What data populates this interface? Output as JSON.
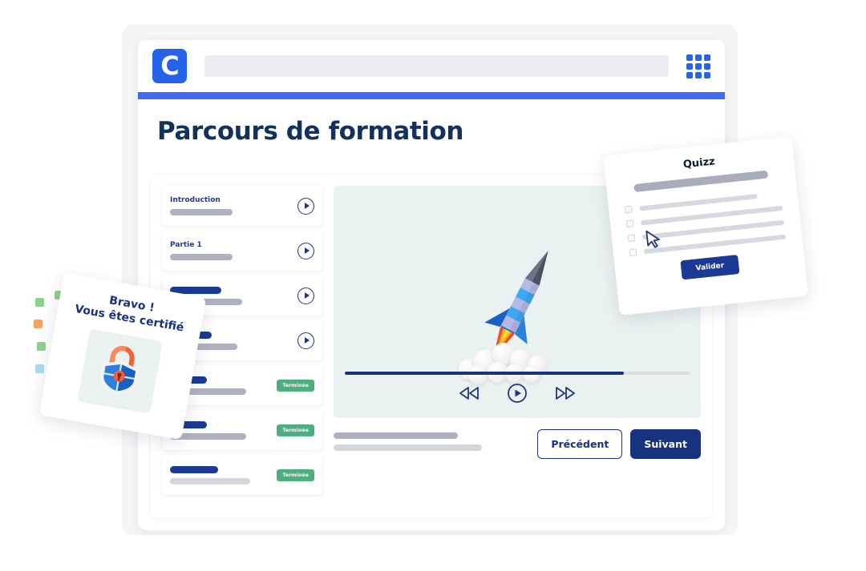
{
  "header": {
    "logo_letter": "C",
    "logo_name": "coorpacademy-logo",
    "search_value": "",
    "search_placeholder": "",
    "apps_icon": "apps-grid-icon",
    "accent_bar_color": "#4169f0",
    "logo_bg_color": "#2563eb"
  },
  "page": {
    "title": "Parcours de formation",
    "title_color": "#12315c",
    "background_color": "#f4f5f7"
  },
  "lessons": [
    {
      "title": "Introduction",
      "has_title": true,
      "action": "play",
      "badge": ""
    },
    {
      "title": "Partie 1",
      "has_title": true,
      "action": "play",
      "badge": ""
    },
    {
      "title": "",
      "has_title": false,
      "action": "play",
      "badge": ""
    },
    {
      "title": "",
      "has_title": false,
      "action": "play",
      "badge": ""
    },
    {
      "title": "",
      "has_title": false,
      "action": "badge",
      "badge": "Terminée"
    },
    {
      "title": "",
      "has_title": false,
      "action": "badge",
      "badge": "Terminée"
    },
    {
      "title": "",
      "has_title": false,
      "action": "badge",
      "badge": "Terminée"
    }
  ],
  "badge_color": "#4caf7d",
  "player": {
    "panel_bg": "#eaf2f1",
    "progress_percent": 81,
    "progress_fill_color": "#17337f",
    "progress_track_color": "#dcdddf",
    "rewind_icon": "rewind-icon",
    "play_icon": "play-icon",
    "forward_icon": "fast-forward-icon",
    "illustration": "rocket-launch-illustration"
  },
  "footer": {
    "previous_label": "Précédent",
    "next_label": "Suivant",
    "button_color": "#17337f"
  },
  "quiz_card": {
    "title": "Quizz",
    "validate_label": "Valider",
    "option_count": 4,
    "cursor_icon": "mouse-cursor-icon",
    "rotation_deg": -6,
    "button_color": "#1b3a96"
  },
  "certificate_card": {
    "line1": "Bravo !",
    "line2": "Vous êtes certifié",
    "badge_icon": "shield-lock-badge",
    "rotation_deg": 10,
    "text_color": "#17337f",
    "confetti_colors": [
      "#8fd18a",
      "#f5a35c",
      "#f2918f",
      "#6ec9e8",
      "#a8d8f0"
    ]
  }
}
